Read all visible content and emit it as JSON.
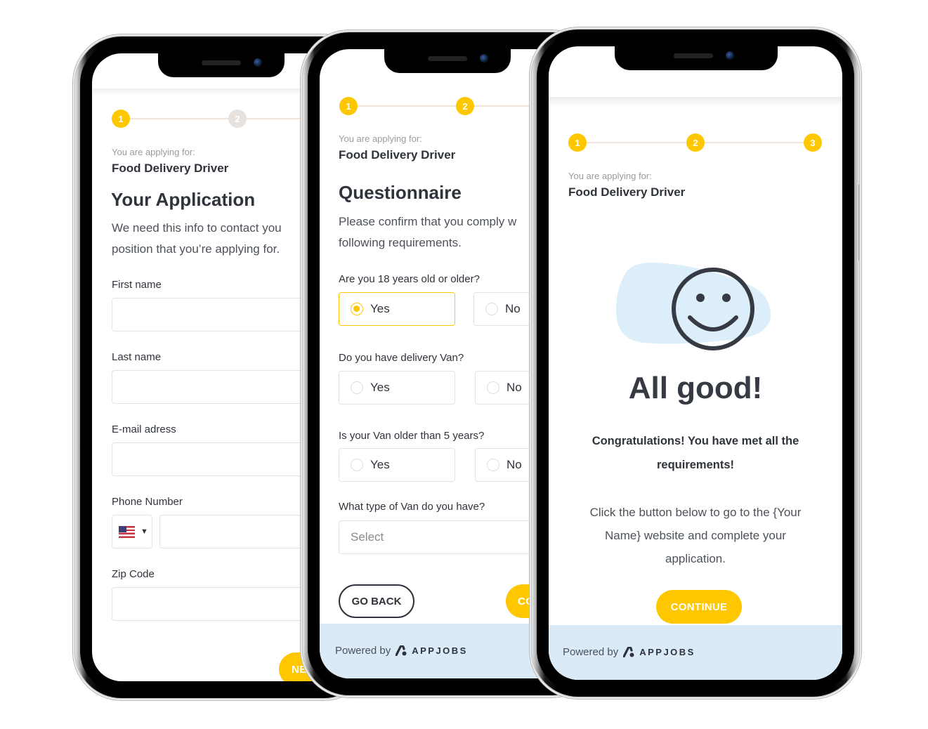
{
  "colors": {
    "accent": "#ffc700",
    "inactive_step": "#e8e1dc",
    "text_dark": "#2f333b",
    "text_muted": "#9b9b9b",
    "footer_bg": "#daeaf7",
    "blob": "#dbeefa"
  },
  "common": {
    "applying_label": "You are applying for:",
    "job_title": "Food Delivery Driver",
    "powered_by": "Powered by",
    "brand": "APPJOBS"
  },
  "phone1": {
    "steps": [
      "1",
      "2"
    ],
    "active_step": 1,
    "heading": "Your Application",
    "description_lines": [
      "We need this info to contact you",
      "position that you’re applying for."
    ],
    "fields": [
      {
        "label": "First name",
        "value": ""
      },
      {
        "label": "Last name",
        "value": ""
      },
      {
        "label": "E-mail adress",
        "value": ""
      },
      {
        "label": "Phone Number",
        "value": "",
        "country_icon": "us-flag-icon"
      },
      {
        "label": "Zip Code",
        "value": ""
      }
    ],
    "next_button": "NE"
  },
  "phone2": {
    "steps": [
      "1",
      "2"
    ],
    "active_step": 2,
    "heading": "Questionnaire",
    "description_lines": [
      "Please confirm that you comply w",
      "following requirements."
    ],
    "questions": [
      {
        "label": "Are you 18 years old or older?",
        "options": [
          "Yes",
          "No"
        ],
        "selected": "Yes"
      },
      {
        "label": "Do you have delivery Van?",
        "options": [
          "Yes",
          "No"
        ],
        "selected": null
      },
      {
        "label": "Is your Van older than 5 years?",
        "options": [
          "Yes",
          "No"
        ],
        "selected": null
      }
    ],
    "select_question": {
      "label": "What type of Van do you have?",
      "placeholder": "Select"
    },
    "go_back_button": "GO BACK",
    "continue_button": "CO"
  },
  "phone3": {
    "steps": [
      "1",
      "2",
      "3"
    ],
    "active_step": 3,
    "heading": "All good!",
    "congrats_lines": [
      "Congratulations! You have met all the",
      "requirements!"
    ],
    "info_lines": [
      "Click the button below to go to the {Your",
      "Name} website and complete your",
      "application."
    ],
    "continue_button": "CONTINUE"
  }
}
